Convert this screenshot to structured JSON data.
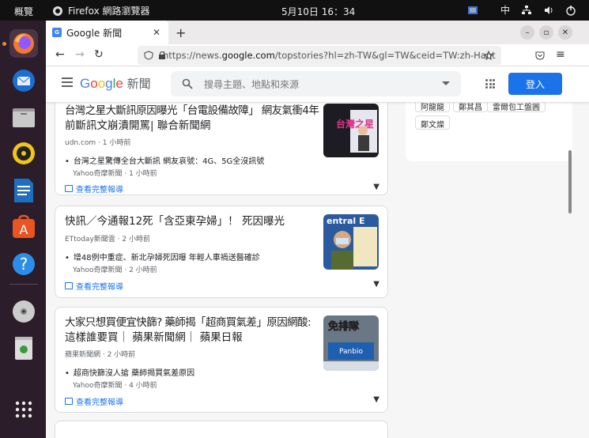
{
  "topbar": {
    "activities": "概覽",
    "app_name": "Firefox 網路瀏覽器",
    "clock": "5月10日  16：34",
    "input_method": "中"
  },
  "browser": {
    "tab_title": "Google 新聞",
    "url_prefix": "https://news.",
    "url_domain": "google.com",
    "url_suffix": "/topstories?hl=zh-TW&gl=TW&ceid=TW:zh-Hant"
  },
  "gn": {
    "logo_google": "Google",
    "logo_news": "新聞",
    "search_placeholder": "搜尋主題、地點和來源",
    "login": "登入"
  },
  "side_tags": [
    "阿龍龍",
    "鄭其昌",
    "雷爾包工盤圓",
    "鄭文燦"
  ],
  "cards": [
    {
      "title_line1": "台灣之星大斷訊原因曝光「台電設備故障」 網友氣衝4年",
      "title_line2": "前斷訊文崩潰開罵| 聯合新聞網",
      "source": "udn.com · 1 小時前",
      "sub": "台灣之星驚傳全台大斷訊 網友哀號：4G、5G全沒訊號",
      "sub_src": "Yahoo奇摩新聞 · 1 小時前",
      "full": "查看完整報導"
    },
    {
      "title_line1": "快訊／今通報12死「含亞東孕婦」！ 死因曝光",
      "title_line2": "",
      "source": "ETtoday新聞雲 · 2 小時前",
      "sub": "增48例中重症、新北孕婦死因曝 年輕人車禍送醫確診",
      "sub_src": "Yahoo奇摩新聞 · 2 小時前",
      "full": "查看完整報導"
    },
    {
      "title_line1": "大家只想買便宜快篩? 藥師揭「超商買氣差」原因網酸:",
      "title_line2": "這樣誰要買｜ 蘋果新聞網｜ 蘋果日報",
      "source": "蘋果新聞網 · 2 小時前",
      "sub": "超商快篩沒人搶 藥師揭買氣差原因",
      "sub_src": "Yahoo奇摩新聞 · 4 小時前",
      "full": "查看完整報導"
    }
  ],
  "thumb_texts": {
    "t1": "台灣之星",
    "t2": "entral E",
    "t3": "免排隊",
    "t3b": "Panbio"
  }
}
